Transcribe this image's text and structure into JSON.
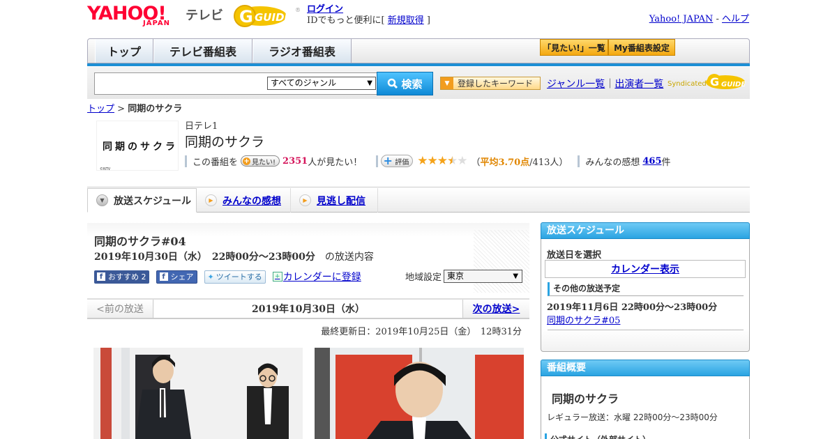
{
  "header": {
    "logo_yahoo": "YAHOO!",
    "logo_japan": "JAPAN",
    "logo_tv": "テレビ",
    "gguide_logo": "G-GUIDE",
    "login": "ログイン",
    "login_sub_prefix": "IDでもっと便利に[ ",
    "signup": "新規取得",
    "login_sub_suffix": " ]",
    "yahoo_japan_link": "Yahoo! JAPAN",
    "dash": " - ",
    "help_link": "ヘルプ"
  },
  "nav": {
    "tabs": [
      "トップ",
      "テレビ番組表",
      "ラジオ番組表"
    ],
    "mitai_list": "「見たい!」一覧",
    "my_schedule": "My番組表設定"
  },
  "search": {
    "input_value": "",
    "genre_selected": "すべてのジャンル",
    "search_button": "検索",
    "keyword_button": "登録したキーワード",
    "genre_list": "ジャンル一覧",
    "divider": "｜",
    "performer_list": "出演者一覧",
    "syndicated": "Syndicated"
  },
  "breadcrumb": {
    "top": "トップ",
    "sep": " > ",
    "current": "同期のサクラ"
  },
  "program": {
    "image_title": "同期のサクラ",
    "image_credit": "©NTV",
    "channel": "日テレ1",
    "title": "同期のサクラ",
    "mitai_prefix": "この番組を",
    "mitai_pill": "見たい!",
    "mitai_count": "2351",
    "mitai_suffix": "人が見たい！",
    "rate_pill": "評価",
    "rating_value": 3.7,
    "rating_open": "（",
    "rating_avg_label": "平均3.70点",
    "rating_count": "/413人）",
    "impressions_prefix": "みんなの感想",
    "impressions_count": "465",
    "impressions_suffix": "件"
  },
  "subtabs": [
    "放送スケジュール",
    "みんなの感想",
    "見逃し配信"
  ],
  "episode": {
    "title": "同期のサクラ#04",
    "date": "2019年10月30日（水）　22時00分～23時00分",
    "date_suffix": "の放送内容",
    "recommend": "おすすめ 2",
    "share": "シェア",
    "tweet": "ツイートする",
    "calendar_register": "カレンダーに登録",
    "region_label": "地域設定",
    "region_value": "東京",
    "prev": "<前の放送",
    "current_date": "2019年10月30日（水）",
    "next": "次の放送>",
    "updated": "最終更新日：2019年10月25日（金）　12時31分"
  },
  "sidebar": {
    "schedule_header": "放送スケジュール",
    "select_date": "放送日を選択",
    "calendar_display": "カレンダー表示",
    "other_header": "その他の放送予定",
    "other_date": "2019年11月6日  22時00分～23時00分",
    "other_link": "同期のサクラ#05",
    "overview_header": "番組概要",
    "overview_title": "同期のサクラ",
    "regular": "レギュラー放送：水曜 22時00分～23時00分",
    "official_site": "公式サイト（外部サイト）"
  },
  "colors": {
    "accent_blue": "#1d8fd5",
    "yahoo_red": "#ff0033",
    "pink": "#d4145a",
    "star": "#f5a31a"
  }
}
